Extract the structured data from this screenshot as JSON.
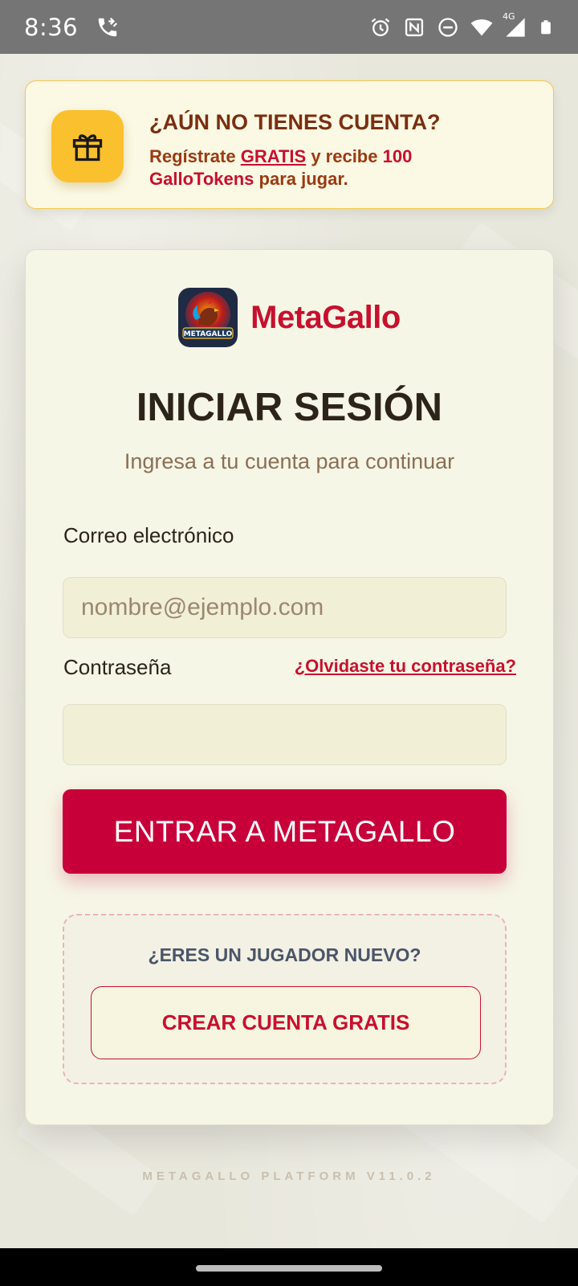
{
  "status_bar": {
    "time": "8:36",
    "icons": [
      "wifi-call-icon",
      "alarm-icon",
      "nfc-icon",
      "do-not-disturb-icon",
      "wifi-icon",
      "signal-4g-icon",
      "battery-icon"
    ],
    "network_label": "4G"
  },
  "promo": {
    "icon": "gift-icon",
    "title": "¿AÚN NO TIENES CUENTA?",
    "text_before": "Regístrate ",
    "text_link": "GRATIS",
    "text_middle": " y recibe ",
    "text_amount": "100 GalloTokens",
    "text_after": " para jugar.",
    "accent_color": "#fbc02d"
  },
  "brand": {
    "name": "MetaGallo",
    "logo_text": "METAGALLO"
  },
  "login": {
    "title": "INICIAR SESIÓN",
    "subtitle": "Ingresa a tu cuenta para continuar",
    "email_label": "Correo electrónico",
    "email_placeholder": "nombre@ejemplo.com",
    "email_value": "",
    "password_label": "Contraseña",
    "password_value": "",
    "forgot_link": "¿Olvidaste tu contraseña?",
    "submit_label": "ENTRAR A METAGALLO",
    "primary_color": "#c8003a"
  },
  "signup": {
    "prompt": "¿ERES UN JUGADOR NUEVO?",
    "button_label": "CREAR CUENTA GRATIS"
  },
  "footer": {
    "version": "METAGALLO PLATFORM V11.0.2"
  }
}
